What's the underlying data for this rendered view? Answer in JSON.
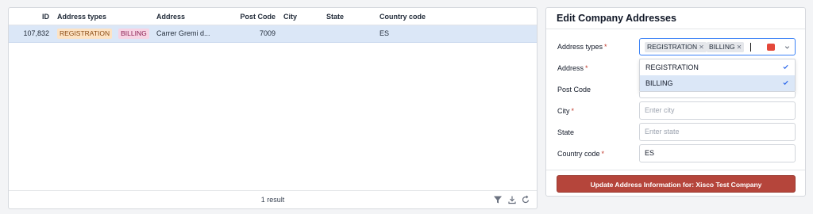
{
  "table": {
    "columns": [
      "ID",
      "Address types",
      "Address",
      "Post Code",
      "City",
      "State",
      "Country code"
    ],
    "rows": [
      {
        "id": "107,832",
        "types": [
          "REGISTRATION",
          "BILLING"
        ],
        "address": "Carrer Gremi d...",
        "post_code": "7009",
        "city": "",
        "state": "",
        "country_code": "ES"
      }
    ],
    "footer": {
      "count": "1 result"
    }
  },
  "form": {
    "title": "Edit Company Addresses",
    "fields": {
      "address_types": {
        "label": "Address types",
        "chips": [
          "REGISTRATION",
          "BILLING"
        ]
      },
      "address": {
        "label": "Address"
      },
      "post_code": {
        "label": "Post Code"
      },
      "city": {
        "label": "City",
        "placeholder": "Enter city"
      },
      "state": {
        "label": "State",
        "placeholder": "Enter state"
      },
      "country_code": {
        "label": "Country code",
        "value": "ES"
      }
    },
    "dropdown_options": [
      {
        "label": "REGISTRATION",
        "checked": true
      },
      {
        "label": "BILLING",
        "checked": true
      }
    ],
    "submit_label": "Update Address Information for: Xisco Test Company"
  },
  "colors": {
    "accent_button": "#b5453b",
    "selected_row": "#dbe7f7",
    "tag_registration": "#fde3c4",
    "tag_billing": "#f7d4e4",
    "required_mark": "#c0392b"
  },
  "icons": [
    "filter-icon",
    "download-icon",
    "refresh-icon",
    "chip-remove-icon",
    "keyboard-icon",
    "chevron-down-icon",
    "check-icon"
  ]
}
